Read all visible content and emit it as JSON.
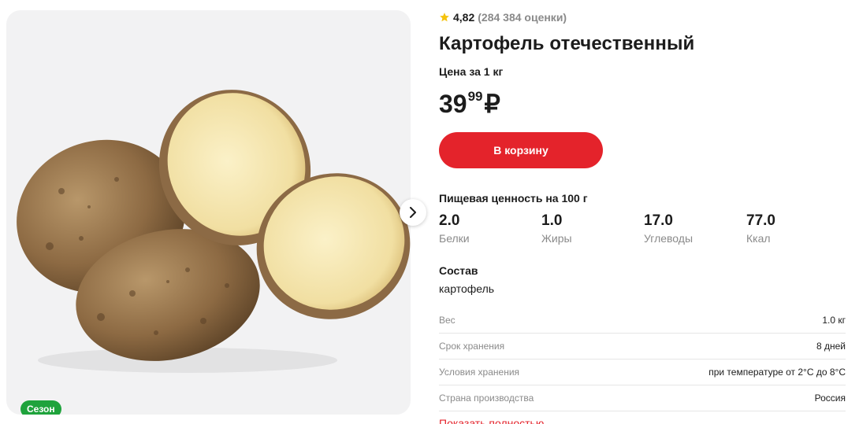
{
  "product": {
    "rating_value": "4,82",
    "rating_count": "(284 384 оценки)",
    "title": "Картофель отечественный",
    "price_unit": "Цена за 1 кг",
    "price_rub": "39",
    "price_kop": "99",
    "currency": "₽",
    "add_to_cart_label": "В корзину",
    "badge": "Сезон"
  },
  "nutrition": {
    "title": "Пищевая ценность на 100 г",
    "items": [
      {
        "value": "2.0",
        "label": "Белки"
      },
      {
        "value": "1.0",
        "label": "Жиры"
      },
      {
        "value": "17.0",
        "label": "Углеводы"
      },
      {
        "value": "77.0",
        "label": "Ккал"
      }
    ]
  },
  "composition": {
    "title": "Состав",
    "text": "картофель"
  },
  "specs": [
    {
      "key": "Вес",
      "value": "1.0 кг"
    },
    {
      "key": "Срок хранения",
      "value": "8 дней"
    },
    {
      "key": "Условия хранения",
      "value": "при температуре от 2°C до 8°C"
    },
    {
      "key": "Страна производства",
      "value": "Россия"
    }
  ],
  "show_all_label": "Показать полностью",
  "colors": {
    "accent_red": "#e4232b",
    "badge_green": "#1fa33c",
    "star_yellow": "#f5c30e",
    "muted_text": "#8a8a8a"
  },
  "icons": {
    "rating": "star-icon",
    "gallery_next": "chevron-right-icon"
  }
}
